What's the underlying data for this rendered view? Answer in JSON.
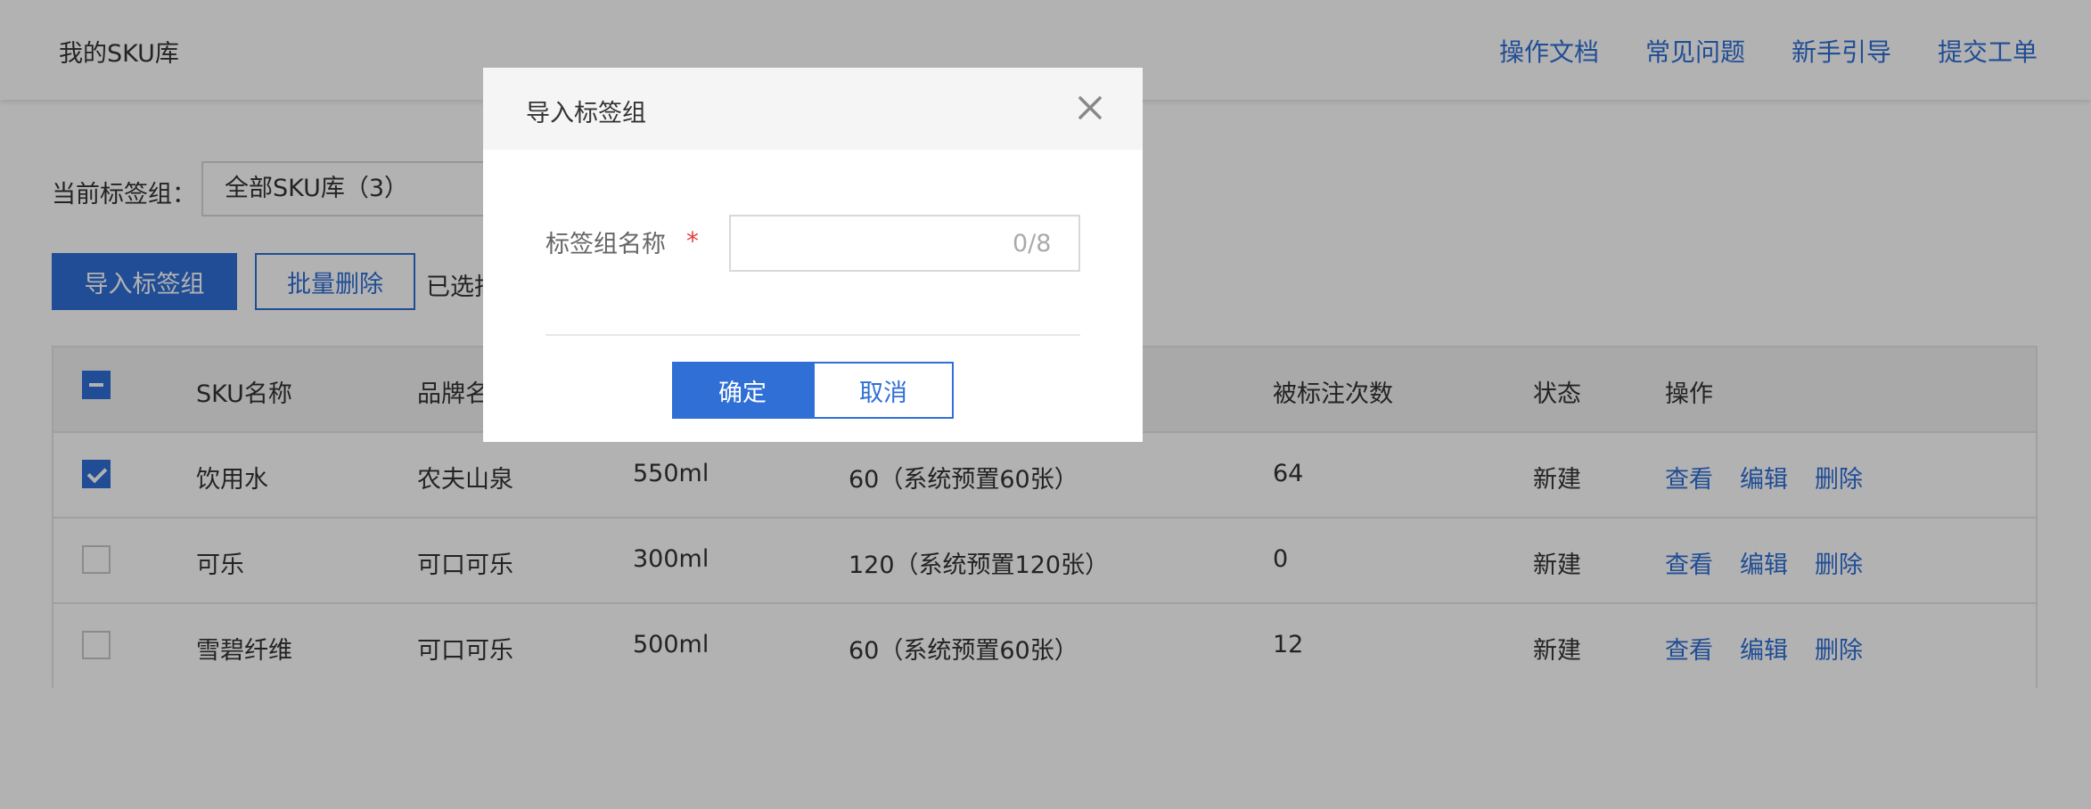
{
  "header": {
    "title": "我的SKU库",
    "links": [
      "操作文档",
      "常见问题",
      "新手引导",
      "提交工单"
    ]
  },
  "filter": {
    "label": "当前标签组：",
    "selected": "全部SKU库（3）"
  },
  "actions": {
    "import_label": "导入标签组",
    "batch_delete_label": "批量删除",
    "selected_text": "已选择"
  },
  "table": {
    "headers": {
      "name": "SKU名称",
      "brand": "品牌名",
      "count": "被标注次数",
      "status": "状态",
      "ops": "操作"
    },
    "rows": [
      {
        "checked": true,
        "name": "饮用水",
        "brand": "农夫山泉",
        "spec": "550ml",
        "images": "60（系统预置60张）",
        "count": "64",
        "status": "新建"
      },
      {
        "checked": false,
        "name": "可乐",
        "brand": "可口可乐",
        "spec": "300ml",
        "images": "120（系统预置120张）",
        "count": "0",
        "status": "新建"
      },
      {
        "checked": false,
        "name": "雪碧纤维",
        "brand": "可口可乐",
        "spec": "500ml",
        "images": "60（系统预置60张）",
        "count": "12",
        "status": "新建"
      }
    ],
    "op_labels": {
      "view": "查看",
      "edit": "编辑",
      "delete": "删除"
    }
  },
  "dialog": {
    "title": "导入标签组",
    "field_label": "标签组名称",
    "required_mark": "*",
    "input_value": "",
    "char_count": "0/8",
    "confirm_label": "确定",
    "cancel_label": "取消"
  },
  "colors": {
    "accent": "#2f6fd6",
    "required": "#e04040",
    "overlay": "rgba(0,0,0,0.30)"
  }
}
